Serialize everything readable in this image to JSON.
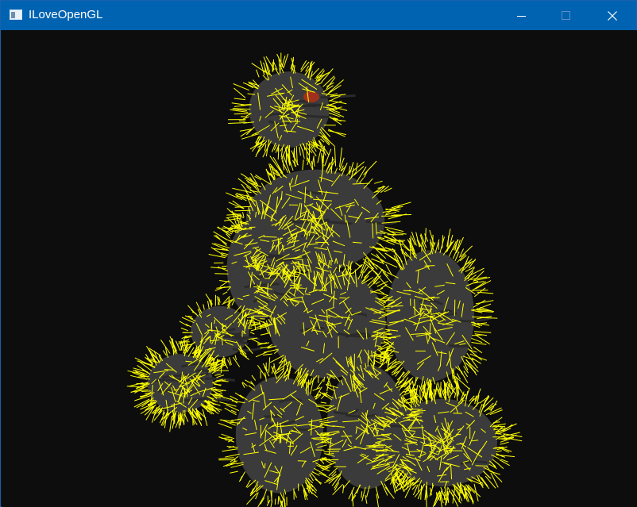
{
  "window": {
    "title": "ILoveOpenGL",
    "icon": "app-window-icon",
    "controls": [
      {
        "name": "minimize",
        "icon": "minimize-icon"
      },
      {
        "name": "maximize",
        "icon": "maximize-icon",
        "disabled": true
      },
      {
        "name": "close",
        "icon": "close-icon"
      }
    ]
  },
  "scene": {
    "background_color": "#0d0d0d",
    "model_color": "#3b3b3b",
    "normal_line_color": "#ffff00",
    "accent_color": "#a0301c"
  }
}
